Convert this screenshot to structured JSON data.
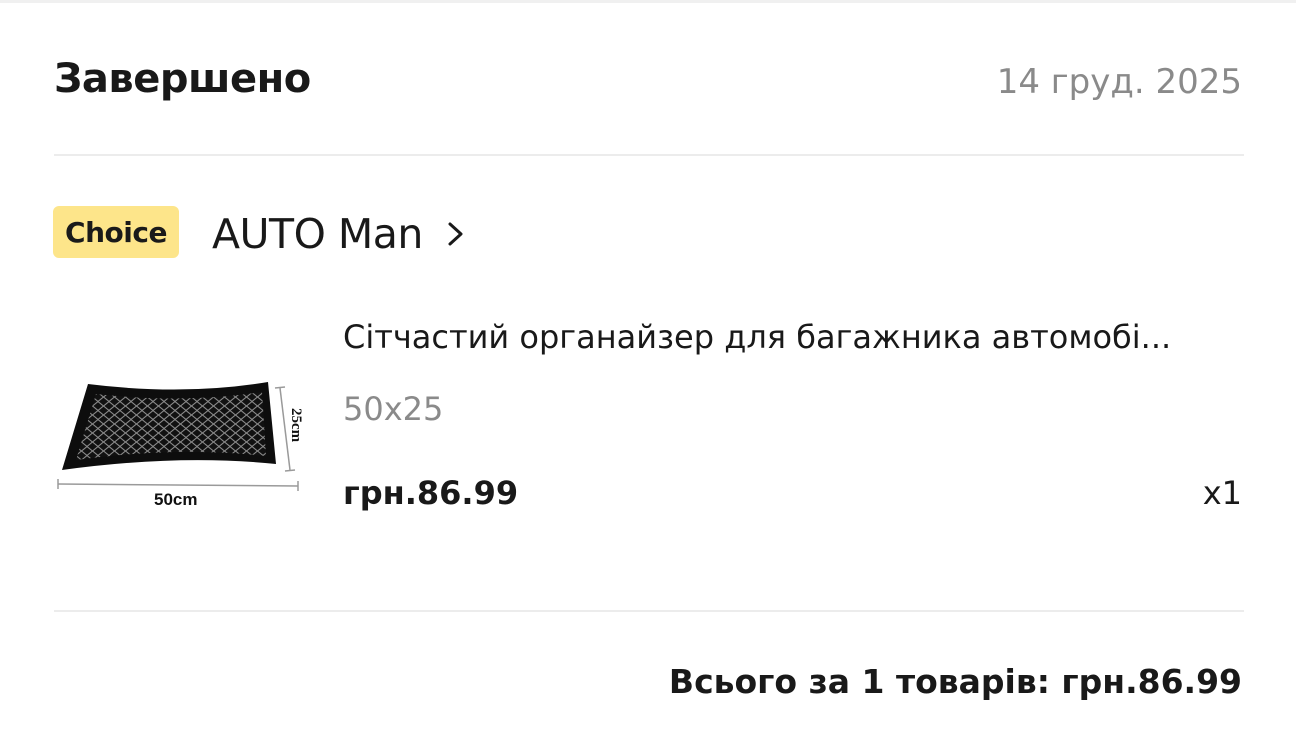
{
  "order": {
    "status": "Завершено",
    "date": "14 груд. 2025"
  },
  "store": {
    "badge": "Choice",
    "name": "AUTO Man",
    "chevron_icon": "chevron-right-icon"
  },
  "item": {
    "image_icon": "car-trunk-net-organizer-image",
    "image_label_width": "50cm",
    "image_label_height": "25cm",
    "title": "Сітчастий органайзер для багажника автомобі...",
    "variant": "50x25",
    "price": "грн.86.99",
    "quantity": "x1"
  },
  "summary": {
    "total": "Всього за 1 товарів: грн.86.99"
  },
  "colors": {
    "badge_bg": "#fde58a",
    "muted_text": "#8a8a8a",
    "divider": "#ececec"
  }
}
